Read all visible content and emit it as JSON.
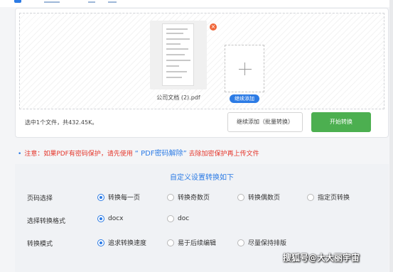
{
  "upload": {
    "file_name": "公司文档 (2).pdf",
    "close_icon": "×",
    "add_tag": "继续添加",
    "status": "选中1个文件，共432.45K。",
    "batch_button": "继续添加（批量转换）",
    "start_button": "开始转换"
  },
  "notice": {
    "prefix": "注意：如果PDF有密码保护，请先使用",
    "link": "“ PDF密码解除”",
    "suffix": "去除加密保护再上传文件"
  },
  "settings": {
    "title": "自定义设置转换如下",
    "rows": [
      {
        "label": "页码选择",
        "options": [
          {
            "label": "转换每一页",
            "selected": true
          },
          {
            "label": "转换奇数页",
            "selected": false
          },
          {
            "label": "转换偶数页",
            "selected": false
          },
          {
            "label": "指定页转换",
            "selected": false
          }
        ]
      },
      {
        "label": "选择转换格式",
        "options": [
          {
            "label": "docx",
            "selected": true
          },
          {
            "label": "doc",
            "selected": false
          }
        ]
      },
      {
        "label": "转换模式",
        "options": [
          {
            "label": "追求转换速度",
            "selected": true
          },
          {
            "label": "易于后续编辑",
            "selected": false
          },
          {
            "label": "尽量保持排版",
            "selected": false
          }
        ]
      }
    ]
  },
  "watermark": "搜狐号@大大丽宇宙",
  "colors": {
    "accent": "#2c7be5",
    "start_button": "#4caf50",
    "notice": "#e5362b"
  }
}
